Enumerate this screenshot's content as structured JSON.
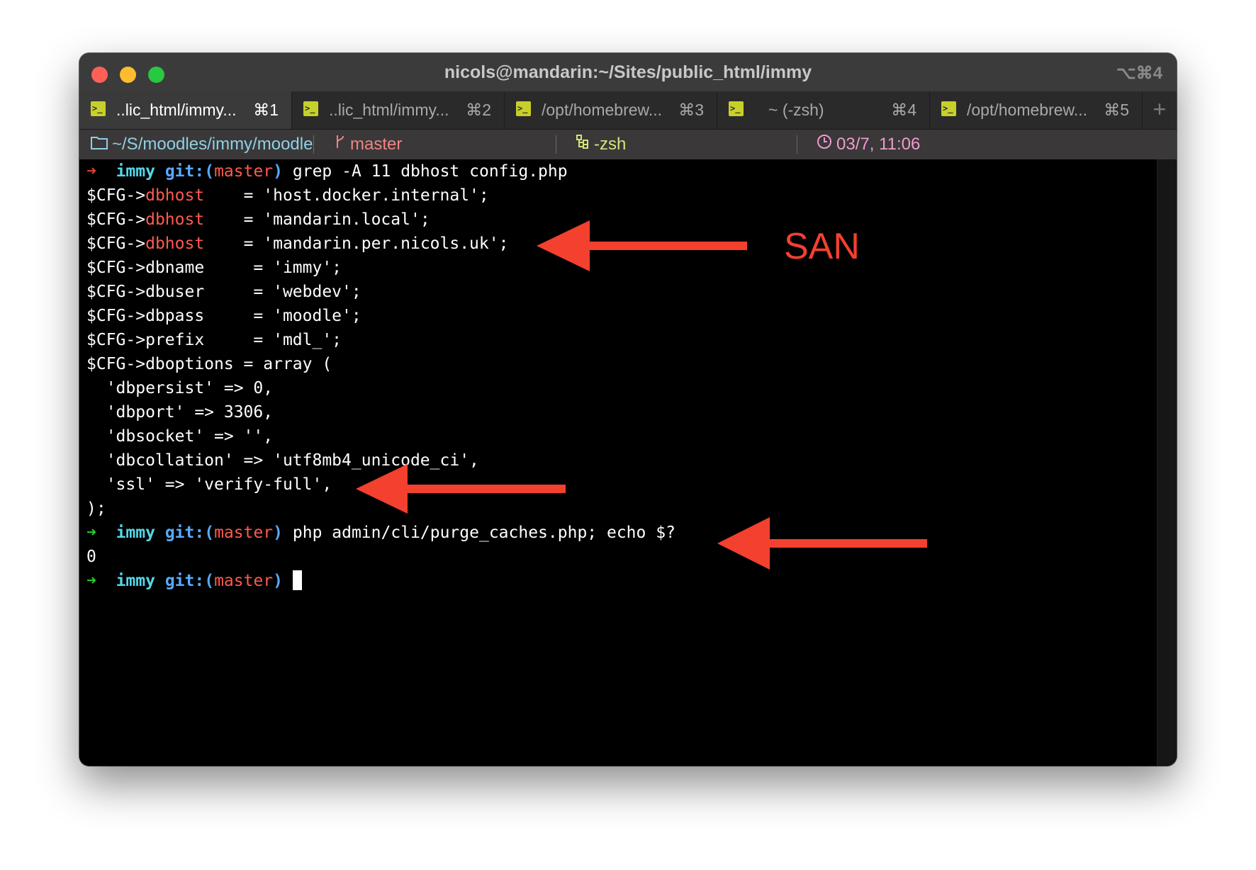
{
  "window": {
    "title": "nicols@mandarin:~/Sites/public_html/immy",
    "shortcut": "⌥⌘4"
  },
  "tabs": [
    {
      "label": "..lic_html/immy...",
      "key": "⌘1",
      "active": true
    },
    {
      "label": "..lic_html/immy...",
      "key": "⌘2"
    },
    {
      "label": "/opt/homebrew...",
      "key": "⌘3"
    },
    {
      "label": "~ (-zsh)",
      "key": "⌘4"
    },
    {
      "label": "/opt/homebrew...",
      "key": "⌘5"
    }
  ],
  "tab_add": "+",
  "tab_icon_glyph": ">_",
  "status": {
    "path": "~/S/moodles/immy/moodle",
    "branch": "master",
    "shell": "-zsh",
    "time": "03/7, 11:06"
  },
  "prompt": {
    "arrow": "➜",
    "dir": "immy",
    "git": "git:(",
    "branch": "master",
    "close": ")"
  },
  "commands": {
    "cmd1": "grep -A 11 dbhost config.php",
    "cmd2": "php admin/cli/purge_caches.php; echo $?"
  },
  "output": {
    "cfg": "$CFG->",
    "dbhost": "dbhost",
    "l1": "    = 'host.docker.internal';",
    "l2": "    = 'mandarin.local';",
    "l3": "    = 'mandarin.per.nicols.uk';",
    "l4": "$CFG->dbname     = 'immy';",
    "l5": "$CFG->dbuser     = 'webdev';",
    "l6": "$CFG->dbpass     = 'moodle';",
    "l7": "$CFG->prefix     = 'mdl_';",
    "l8": "$CFG->dboptions = array (",
    "l9": "  'dbpersist' => 0,",
    "l10": "  'dbport' => 3306,",
    "l11": "  'dbsocket' => '',",
    "l12": "  'dbcollation' => 'utf8mb4_unicode_ci',",
    "l13": "  'ssl' => 'verify-full',",
    "l14": ");",
    "exit_code": "0"
  },
  "annotation": {
    "label": "SAN",
    "color": "#f4402e"
  },
  "colors": {
    "prompt_arrow_ok": "#2ad02a",
    "prompt_arrow_err": "#e0443c",
    "dir": "#56d6e8",
    "git": "#5aa9ff",
    "branch": "#ff5a4e"
  }
}
